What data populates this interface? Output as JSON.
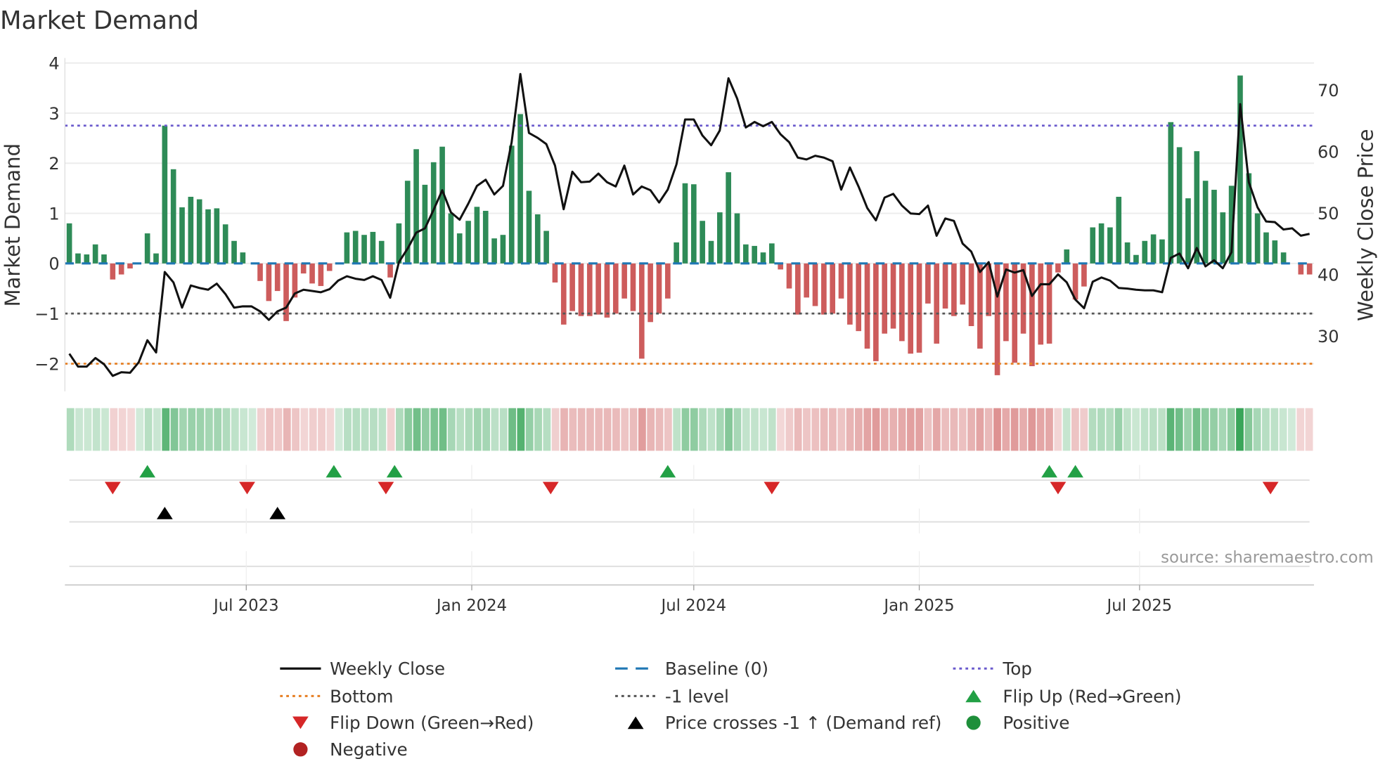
{
  "chart_data": {
    "type": "bar",
    "title": "Market Demand",
    "ylabel": "Market Demand",
    "y2label": "Weekly Close Price",
    "ylim": [
      -2.55,
      4.1
    ],
    "y2lim": [
      21,
      75.2
    ],
    "yticks": [
      4,
      3,
      2,
      1,
      0,
      -1,
      -2
    ],
    "ytick_labels": [
      "4",
      "3",
      "2",
      "1",
      "0",
      "−1",
      "−2"
    ],
    "y2ticks": [
      70,
      60,
      50,
      40,
      30
    ],
    "y2tick_labels": [
      "70",
      "60",
      "50",
      "40",
      "30"
    ],
    "xticks": [
      {
        "label": "Jul 2023",
        "week": 20.4
      },
      {
        "label": "Jan 2024",
        "week": 46.4
      },
      {
        "label": "Jul 2024",
        "week": 72
      },
      {
        "label": "Jan 2025",
        "week": 98
      },
      {
        "label": "Jul 2025",
        "week": 123.4
      }
    ],
    "reference_lines": {
      "top": 2.75,
      "bottom": -2.0,
      "minus_one": -1.0,
      "baseline": 0
    },
    "demand": [
      0.8,
      0.2,
      0.18,
      0.38,
      0.18,
      -0.32,
      -0.22,
      -0.1,
      0,
      0.6,
      0.2,
      2.75,
      1.88,
      1.12,
      1.33,
      1.28,
      1.08,
      1.1,
      0.78,
      0.45,
      0.22,
      0,
      -0.35,
      -0.75,
      -0.55,
      -1.15,
      -0.68,
      -0.2,
      -0.4,
      -0.45,
      -0.15,
      0,
      0.62,
      0.65,
      0.57,
      0.63,
      0.45,
      -0.28,
      0.8,
      1.65,
      2.28,
      1.57,
      2.02,
      2.33,
      1.0,
      0.6,
      0.85,
      1.13,
      1.05,
      0.5,
      0.57,
      2.35,
      2.98,
      1.45,
      0.98,
      0.65,
      -0.38,
      -1.22,
      -0.95,
      -1.05,
      -1.05,
      -1.02,
      -1.08,
      -1.0,
      -0.7,
      -0.95,
      -1.9,
      -1.17,
      -1.0,
      -0.7,
      0.42,
      1.6,
      1.58,
      0.85,
      0.45,
      1.02,
      1.82,
      1.0,
      0.38,
      0.35,
      0.22,
      0.4,
      -0.12,
      -0.5,
      -1.02,
      -0.68,
      -0.85,
      -1.02,
      -1.0,
      -0.7,
      -1.22,
      -1.35,
      -1.7,
      -1.95,
      -1.4,
      -1.3,
      -1.55,
      -1.8,
      -1.78,
      -0.8,
      -1.6,
      -0.9,
      -1.05,
      -0.82,
      -1.25,
      -1.7,
      -1.05,
      -2.23,
      -1.55,
      -1.98,
      -1.4,
      -2.05,
      -1.62,
      -1.6,
      -0.18,
      0.28,
      -0.72,
      -0.46,
      0.72,
      0.8,
      0.72,
      1.33,
      0.42,
      0.17,
      0.45,
      0.58,
      0.48,
      2.82,
      2.32,
      1.3,
      2.24,
      1.65,
      1.47,
      1.02,
      1.55,
      3.75,
      1.8,
      1.0,
      0.62,
      0.46,
      0.22,
      0,
      -0.22,
      -0.22
    ],
    "weekly_close": [
      27.1,
      25,
      25,
      26.4,
      25.4,
      23.5,
      24.1,
      24,
      25.7,
      29.3,
      27.3,
      40.4,
      38.7,
      34.6,
      38.2,
      37.8,
      37.5,
      38.5,
      36.8,
      34.6,
      34.8,
      34.8,
      34,
      32.6,
      34,
      34.6,
      36.9,
      37.5,
      37.3,
      37.1,
      37.6,
      39,
      39.7,
      39.3,
      39.1,
      39.7,
      39.1,
      36.2,
      42,
      44.2,
      46.8,
      47.5,
      50.5,
      53.7,
      50.1,
      48.9,
      51.5,
      54.4,
      55.4,
      53,
      54.4,
      61.5,
      72.6,
      63,
      62.2,
      61.2,
      57.7,
      50.6,
      56.7,
      55,
      55.1,
      56.4,
      55,
      54.3,
      57.7,
      53,
      54.3,
      53.7,
      51.7,
      53.8,
      57.9,
      65.2,
      65.2,
      62.6,
      61,
      63.4,
      71.9,
      68.6,
      63.9,
      64.8,
      64.1,
      64.8,
      62.8,
      61.5,
      59,
      58.7,
      59.3,
      59,
      58.4,
      53.8,
      57.4,
      54.3,
      50.8,
      48.8,
      52.5,
      53.1,
      51.2,
      49.9,
      49.8,
      51.2,
      46.3,
      49.1,
      48.7,
      45,
      43.7,
      40.4,
      42,
      36.4,
      40.8,
      40.3,
      40.7,
      36.5,
      38.4,
      38.4,
      40,
      38.7,
      35.9,
      34.5,
      38.8,
      39.5,
      39,
      37.8,
      37.7,
      37.5,
      37.4,
      37.4,
      37.1,
      42.7,
      43.4,
      41,
      44.3,
      41.3,
      42.3,
      41,
      43.6,
      67.7,
      55,
      50.9,
      48.6,
      48.5,
      47.3,
      47.5,
      46.3,
      46.6
    ],
    "flip_up_weeks": [
      9,
      30.5,
      37.5,
      69,
      113,
      116
    ],
    "flip_down_weeks": [
      5,
      20.5,
      36.5,
      55.5,
      81,
      114,
      138.5
    ],
    "price_cross_weeks": [
      11,
      24
    ],
    "source": "source: sharemaestro.com",
    "legend": [
      {
        "label": "Weekly Close",
        "symbol": "line",
        "color": "#111111"
      },
      {
        "label": "Baseline (0)",
        "symbol": "dash",
        "color": "#1f77b4"
      },
      {
        "label": "Top",
        "symbol": "dot",
        "color": "#6a5acd"
      },
      {
        "label": "Bottom",
        "symbol": "dot",
        "color": "#e67e22"
      },
      {
        "label": "-1 level",
        "symbol": "dot",
        "color": "#555555"
      },
      {
        "label": "Flip Up (Red→Green)",
        "symbol": "tri-up",
        "color": "#22a045"
      },
      {
        "label": "Flip Down (Green→Red)",
        "symbol": "tri-down",
        "color": "#d62728"
      },
      {
        "label": "Price crosses -1 ↑ (Demand ref)",
        "symbol": "tri-up",
        "color": "#000000"
      },
      {
        "label": "Positive",
        "symbol": "circle",
        "color": "#1e8f3a"
      },
      {
        "label": "Negative",
        "symbol": "circle",
        "color": "#b22222"
      }
    ],
    "colors": {
      "positive": "#2e8b57",
      "negative": "#cd5c5c",
      "line": "#111111"
    }
  }
}
